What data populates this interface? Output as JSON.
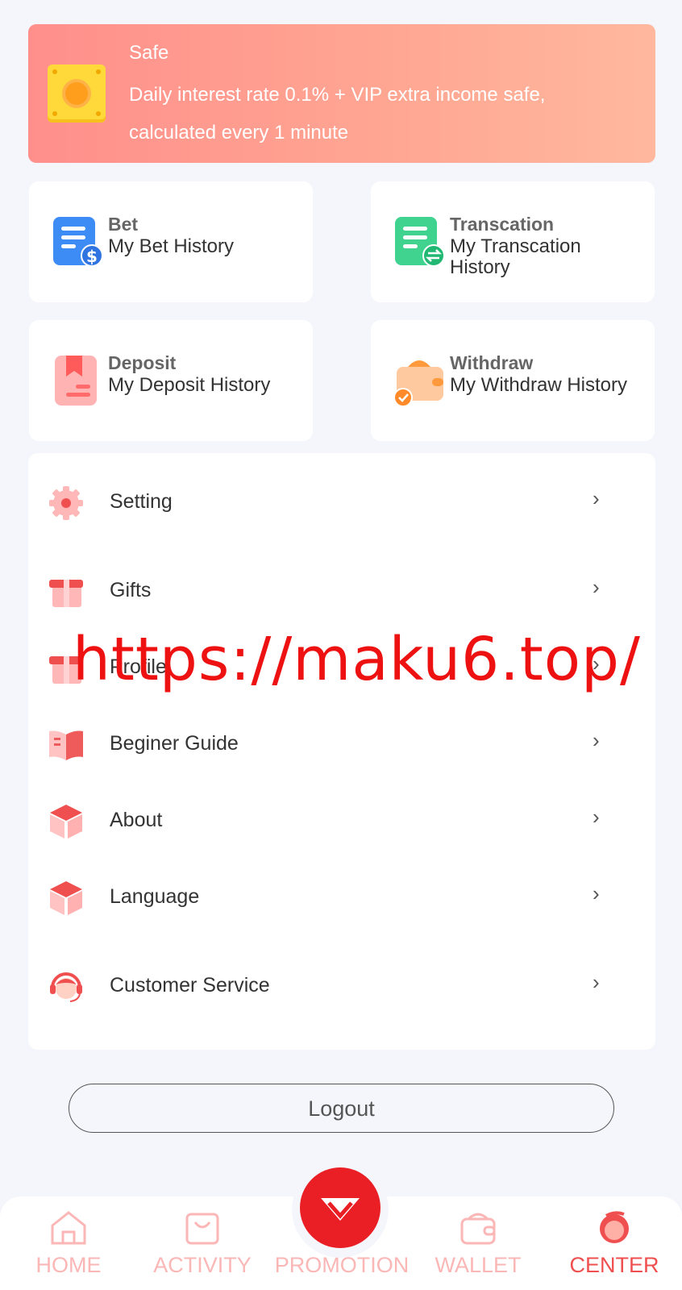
{
  "safe": {
    "title": "Safe",
    "description": "Daily interest rate 0.1% + VIP extra income safe, calculated every 1 minute"
  },
  "cards": [
    {
      "title": "Bet",
      "subtitle": "My Bet History",
      "icon": "bet-document-icon",
      "color": "#3d8cf5"
    },
    {
      "title": "Transcation",
      "subtitle": "My Transcation History",
      "icon": "transaction-document-icon",
      "color": "#3fd38f"
    },
    {
      "title": "Deposit",
      "subtitle": "My Deposit History",
      "icon": "deposit-bookmark-icon",
      "color": "#ff8f8f"
    },
    {
      "title": "Withdraw",
      "subtitle": "My Withdraw History",
      "icon": "withdraw-wallet-icon",
      "color": "#ffa25c"
    }
  ],
  "menu": [
    {
      "label": "Setting",
      "icon": "gear-icon"
    },
    {
      "label": "Gifts",
      "icon": "gift-icon"
    },
    {
      "label": "Profile",
      "icon": "profile-gift-icon"
    },
    {
      "label": "Beginer Guide",
      "icon": "book-icon"
    },
    {
      "label": "About",
      "icon": "cube-icon"
    },
    {
      "label": "Language",
      "icon": "cube-icon"
    },
    {
      "label": "Customer Service",
      "icon": "headset-agent-icon"
    }
  ],
  "watermark": "https://maku6.top/",
  "logout_label": "Logout",
  "tabs": [
    {
      "label": "HOME",
      "icon": "home-icon",
      "active": false
    },
    {
      "label": "ACTIVITY",
      "icon": "shopping-bag-icon",
      "active": false
    },
    {
      "label": "PROMOTION",
      "icon": "diamond-icon",
      "active": false
    },
    {
      "label": "WALLET",
      "icon": "wallet-icon",
      "active": false
    },
    {
      "label": "CENTER",
      "icon": "user-center-icon",
      "active": true
    }
  ],
  "colors": {
    "accent": "#ef4f4f",
    "background": "#f5f6fc",
    "banner_start": "#ff8f8b",
    "banner_end": "#ffb89e"
  }
}
